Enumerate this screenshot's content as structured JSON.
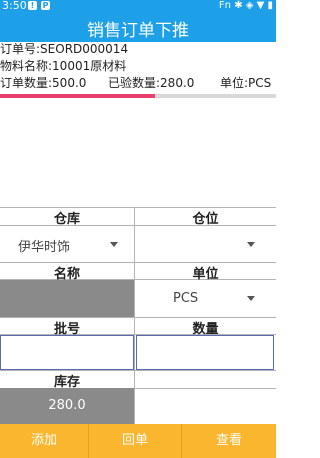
{
  "status_bar": {
    "time": "3:50",
    "icon_a": "!",
    "icon_b": "P",
    "right_icons": "Fn ✱ ◈ ▼ ▮"
  },
  "header": {
    "title": "销售订单下推"
  },
  "order": {
    "order_no_line": "订单号:SEORD000014",
    "material_line": "物料名称:10001原材料",
    "quantity_line": "订单数量:500.0",
    "checked_line": "已验数量:280.0",
    "unit_line": "单位:PCS",
    "progress_fraction": 0.56,
    "progress_color": "#e83f6f"
  },
  "form": {
    "warehouse_label": "仓库",
    "location_label": "仓位",
    "warehouse_value": "伊华时饰",
    "location_value": "",
    "name_label": "名称",
    "unit_label": "单位",
    "name_value": "",
    "unit_value": "PCS",
    "batch_label": "批号",
    "quantity_label": "数量",
    "batch_value": "",
    "quantity_value": "",
    "stock_label": "库存",
    "stock_value": "280.0"
  },
  "footer": {
    "add_label": "添加",
    "return_label": "回单",
    "view_label": "查看",
    "color": "#f9b62e"
  }
}
